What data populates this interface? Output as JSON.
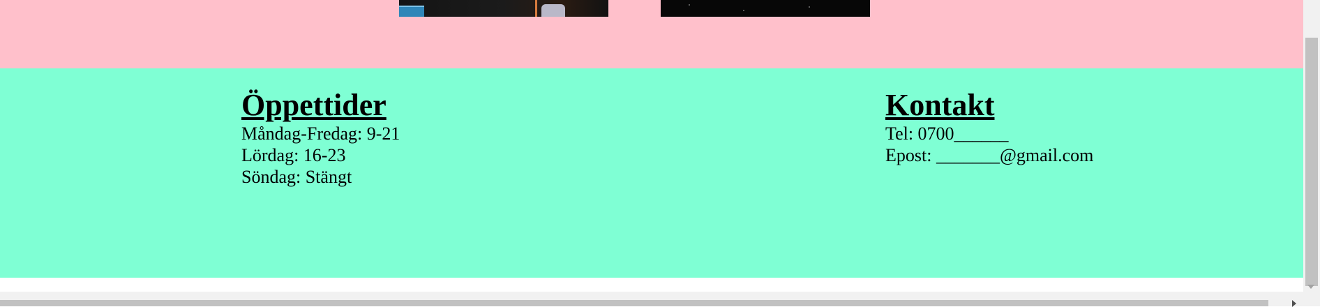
{
  "colors": {
    "gallery_background": "#ffc0cb",
    "footer_background": "#7fffd4",
    "text": "#000000"
  },
  "gallery": {
    "images": [
      {
        "description_icon": "photo-icon"
      },
      {
        "description_icon": "photo-icon"
      }
    ]
  },
  "footer": {
    "hours": {
      "heading": "Öppettider",
      "lines": [
        "Måndag-Fredag: 9-21",
        "Lördag: 16-23",
        "Söndag: Stängt"
      ]
    },
    "contact": {
      "heading": "Kontakt",
      "phone": "Tel: 0700______",
      "email": "Epost: _______@gmail.com"
    }
  }
}
